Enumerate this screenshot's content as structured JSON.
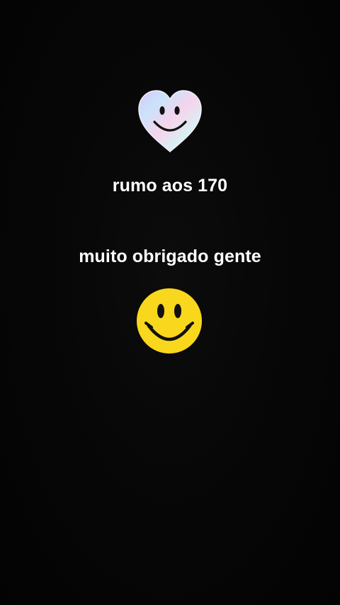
{
  "story": {
    "line_1": "rumo aos 170",
    "line_2": "muito obrigado gente"
  },
  "stickers": {
    "top": "holographic-heart-smiley-icon",
    "bottom": "yellow-smiley-face-icon"
  },
  "colors": {
    "background": "#050505",
    "text": "#ffffff",
    "smiley_yellow": "#f9d71c"
  }
}
